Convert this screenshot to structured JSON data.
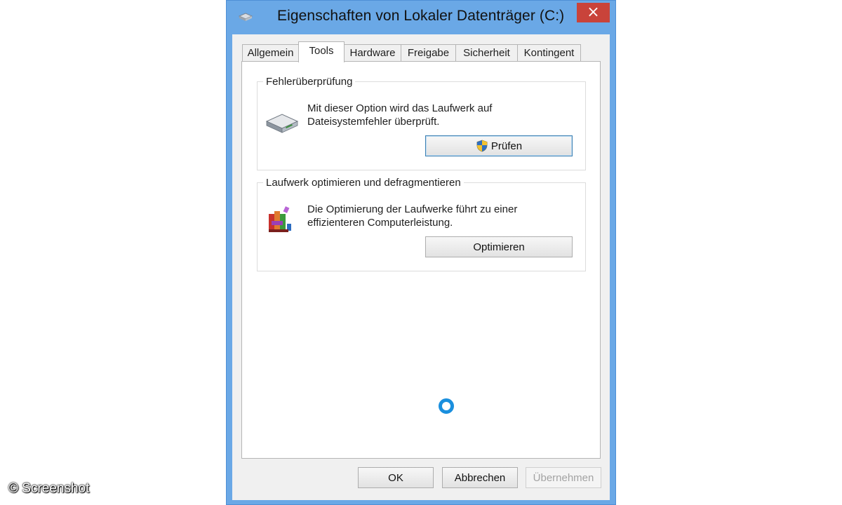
{
  "window": {
    "title": "Eigenschaften von Lokaler Datenträger (C:)",
    "close_label": "×"
  },
  "tabs": [
    {
      "label": "Allgemein",
      "active": false
    },
    {
      "label": "Tools",
      "active": true
    },
    {
      "label": "Hardware",
      "active": false
    },
    {
      "label": "Freigabe",
      "active": false
    },
    {
      "label": "Sicherheit",
      "active": false
    },
    {
      "label": "Kontingent",
      "active": false
    }
  ],
  "error_check": {
    "title": "Fehlerüberprüfung",
    "description_line1": "Mit dieser Option wird das Laufwerk auf",
    "description_line2": "Dateisystemfehler überprüft.",
    "button_label": "Prüfen",
    "icon": "hard-drive-icon"
  },
  "optimize": {
    "title": "Laufwerk optimieren und defragmentieren",
    "description_line1": "Die Optimierung der Laufwerke führt zu einer",
    "description_line2": "effizienteren Computerleistung.",
    "button_label": "Optimieren",
    "icon": "defrag-icon"
  },
  "footer": {
    "ok_label": "OK",
    "cancel_label": "Abbrechen",
    "apply_label": "Übernehmen"
  },
  "watermark": "© Screenshot",
  "colors": {
    "frame": "#6aa8e6",
    "close": "#c9433a",
    "spinner": "#1a8fde"
  }
}
